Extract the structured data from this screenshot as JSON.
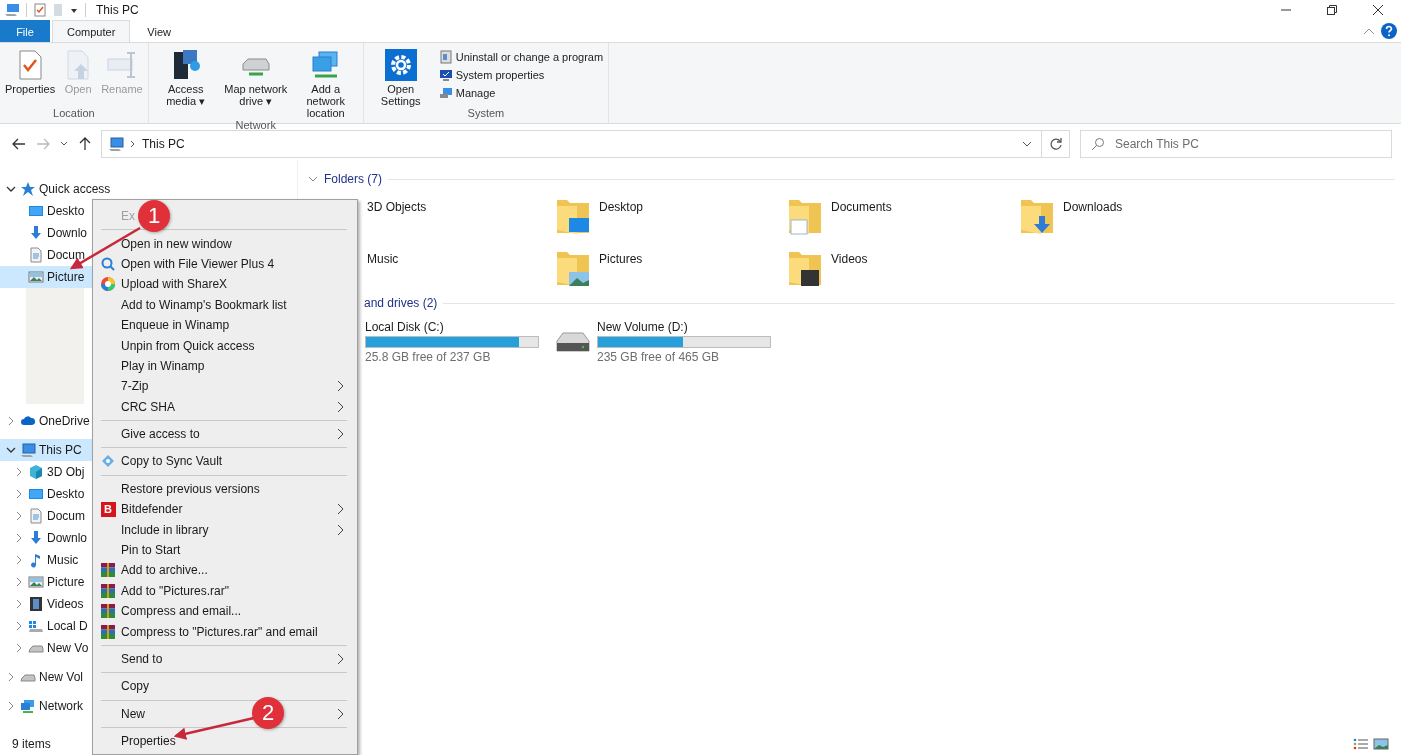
{
  "window": {
    "title": "This PC"
  },
  "ribbon_tabs": [
    {
      "label": "File",
      "kind": "file",
      "selected": false
    },
    {
      "label": "Computer",
      "kind": "tab",
      "selected": true
    },
    {
      "label": "View",
      "kind": "tab",
      "selected": false
    }
  ],
  "ribbon_groups": [
    {
      "label": "Location",
      "buttons": [
        {
          "label": "Properties",
          "disabled": false
        },
        {
          "label": "Open",
          "disabled": true
        },
        {
          "label": "Rename",
          "disabled": true
        }
      ]
    },
    {
      "label": "Network",
      "buttons": [
        {
          "label": "Access media",
          "dropdown": "▾",
          "disabled": false
        },
        {
          "label": "Map network drive",
          "dropdown": "▾",
          "disabled": false
        },
        {
          "label": "Add a network location",
          "disabled": false
        }
      ]
    },
    {
      "label": "System",
      "buttons": [
        {
          "label": "Open Settings",
          "disabled": false
        }
      ],
      "small_buttons": [
        {
          "label": "Uninstall or change a program"
        },
        {
          "label": "System properties"
        },
        {
          "label": "Manage"
        }
      ]
    }
  ],
  "address_bar": {
    "path": "This PC"
  },
  "search": {
    "placeholder": "Search This PC"
  },
  "sidebar": [
    {
      "label": "Quick access",
      "expanded": true,
      "selected": false,
      "children": [
        {
          "label": "Deskto",
          "selected": false
        },
        {
          "label": "Downlo",
          "selected": false
        },
        {
          "label": "Docum",
          "selected": false
        },
        {
          "label": "Picture",
          "selected": true
        }
      ]
    },
    {
      "label": "OneDrive",
      "expanded": false,
      "selected": false
    },
    {
      "label": "This PC",
      "expanded": true,
      "selected": true,
      "children": [
        {
          "label": "3D Obj",
          "expanded": false,
          "selected": false
        },
        {
          "label": "Deskto",
          "expanded": false,
          "selected": false
        },
        {
          "label": "Docum",
          "expanded": false,
          "selected": false
        },
        {
          "label": "Downlo",
          "expanded": false,
          "selected": false
        },
        {
          "label": "Music",
          "expanded": false,
          "selected": false
        },
        {
          "label": "Picture",
          "expanded": false,
          "selected": false
        },
        {
          "label": "Videos",
          "expanded": false,
          "selected": false
        },
        {
          "label": "Local D",
          "expanded": false,
          "selected": false
        },
        {
          "label": "New Vo",
          "expanded": false,
          "selected": false
        }
      ]
    },
    {
      "label": "New Vol",
      "expanded": false,
      "selected": false
    },
    {
      "label": "Network",
      "expanded": false,
      "selected": false
    }
  ],
  "sections": [
    {
      "title": "Folders (7)",
      "chevron": true,
      "kind": "folders",
      "items": [
        {
          "label": "3D Objects"
        },
        {
          "label": "Desktop"
        },
        {
          "label": "Documents"
        },
        {
          "label": "Downloads"
        },
        {
          "label": "Music"
        },
        {
          "label": "Pictures"
        },
        {
          "label": "Videos"
        }
      ]
    },
    {
      "title": "and drives (2)",
      "kind": "drives",
      "items": [
        {
          "label": "Local Disk (C:)",
          "level": 0.891,
          "free": "25.8 GB free of 237 GB"
        },
        {
          "label": "New Volume (D:)",
          "level": 0.495,
          "free": "235 GB free of 465 GB"
        }
      ]
    }
  ],
  "context_menu": [
    {
      "kind": "item",
      "label": "Ex",
      "submenu": false,
      "disabled": true
    },
    {
      "kind": "separator"
    },
    {
      "kind": "item",
      "label": "Open in new window",
      "submenu": false,
      "disabled": false
    },
    {
      "kind": "item",
      "label": "Open with File Viewer Plus 4",
      "submenu": false,
      "disabled": false
    },
    {
      "kind": "item",
      "label": "Upload with ShareX",
      "submenu": false,
      "disabled": false
    },
    {
      "kind": "item",
      "label": "Add to Winamp's Bookmark list",
      "submenu": false,
      "disabled": false
    },
    {
      "kind": "item",
      "label": "Enqueue in Winamp",
      "submenu": false,
      "disabled": false
    },
    {
      "kind": "item",
      "label": "Unpin from Quick access",
      "submenu": false,
      "disabled": false
    },
    {
      "kind": "item",
      "label": "Play in Winamp",
      "submenu": false,
      "disabled": false
    },
    {
      "kind": "item",
      "label": "7-Zip",
      "submenu": true,
      "disabled": false
    },
    {
      "kind": "item",
      "label": "CRC SHA",
      "submenu": true,
      "disabled": false
    },
    {
      "kind": "separator"
    },
    {
      "kind": "item",
      "label": "Give access to",
      "submenu": true,
      "disabled": false
    },
    {
      "kind": "separator"
    },
    {
      "kind": "item",
      "label": "Copy to Sync Vault",
      "submenu": false,
      "disabled": false
    },
    {
      "kind": "separator"
    },
    {
      "kind": "item",
      "label": "Restore previous versions",
      "submenu": false,
      "disabled": false
    },
    {
      "kind": "item",
      "label": "Bitdefender",
      "icon_text": "B",
      "submenu": true,
      "disabled": false
    },
    {
      "kind": "item",
      "label": "Include in library",
      "submenu": true,
      "disabled": false
    },
    {
      "kind": "item",
      "label": "Pin to Start",
      "submenu": false,
      "disabled": false
    },
    {
      "kind": "item",
      "label": "Add to archive...",
      "submenu": false,
      "disabled": false
    },
    {
      "kind": "item",
      "label": "Add to \"Pictures.rar\"",
      "submenu": false,
      "disabled": false
    },
    {
      "kind": "item",
      "label": "Compress and email...",
      "submenu": false,
      "disabled": false
    },
    {
      "kind": "item",
      "label": "Compress to \"Pictures.rar\" and email",
      "submenu": false,
      "disabled": false
    },
    {
      "kind": "separator"
    },
    {
      "kind": "item",
      "label": "Send to",
      "submenu": true,
      "disabled": false
    },
    {
      "kind": "separator"
    },
    {
      "kind": "item",
      "label": "Copy",
      "submenu": false,
      "disabled": false
    },
    {
      "kind": "separator"
    },
    {
      "kind": "item",
      "label": "New",
      "submenu": true,
      "disabled": false
    },
    {
      "kind": "separator"
    },
    {
      "kind": "item",
      "label": "Properties",
      "submenu": false,
      "disabled": false
    }
  ],
  "callouts": [
    {
      "label": "1"
    },
    {
      "label": "2"
    }
  ],
  "status_bar": {
    "items": "9 items"
  }
}
